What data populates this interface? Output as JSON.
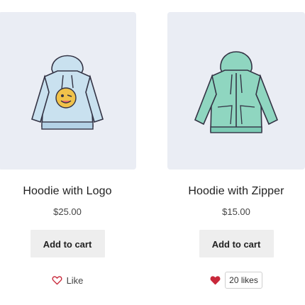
{
  "products": [
    {
      "title": "Hoodie with Logo",
      "price": "$25.00",
      "cart_label": "Add to cart",
      "like_label": "Like",
      "liked": false
    },
    {
      "title": "Hoodie with Zipper",
      "price": "$15.00",
      "cart_label": "Add to cart",
      "likes_count": "20 likes",
      "liked": true
    }
  ],
  "colors": {
    "image_bg": "#eaedf4",
    "button_bg": "#eeeeee",
    "heart": "#c8283a",
    "hoodie_logo": "#c9e1ef",
    "hoodie_zipper": "#8fd6c0"
  },
  "icons": [
    "heart-outline-icon",
    "heart-filled-icon"
  ]
}
